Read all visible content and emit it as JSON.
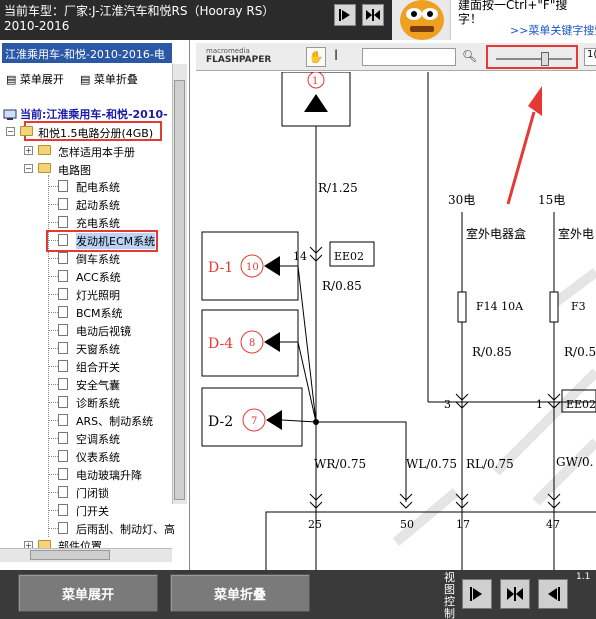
{
  "header": {
    "car_label": "当前车型：厂家:J-江淮汽车和悦RS（Hooray RS）",
    "car_year": "2010-2016",
    "btn_prev_icon": "arrow-right-icon",
    "btn_split_icon": "double-arrow-icon"
  },
  "promo": {
    "line1": "建面按一Ctrl+\"F\"搜",
    "line2": "字！",
    "link": ">>菜单关键字搜索"
  },
  "sidebar": {
    "title": "江淮乘用车-和悦-2010-2016-电",
    "expand_label": "菜单展开",
    "collapse_label": "菜单折叠",
    "current": "当前:江淮乘用车-和悦-2010-",
    "root_folder": "和悦1.5电路分册(4GB)",
    "folder_howto": "怎样适用本手册",
    "folder_circuit": "电路图",
    "items": [
      "配电系统",
      "起动系统",
      "充电系统",
      "发动机ECM系统",
      "倒车系统",
      "ACC系统",
      "灯光照明",
      "BCM系统",
      "电动后视镜",
      "天窗系统",
      "组合开关",
      "安全气囊",
      "诊断系统",
      "ARS、制动系统",
      "空调系统",
      "仪表系统",
      "电动玻璃升降",
      "门闭锁",
      "门开关",
      "后雨刮、制动灯、高"
    ],
    "folder_parts": "部件位置"
  },
  "toolbar": {
    "logo_brand": "macromedia",
    "logo_product": "FLASHPAPER",
    "zoom_value": "1("
  },
  "diagram": {
    "labels": {
      "r125": "R/1.25",
      "num14": "14",
      "ee02a": "EE02",
      "r085a": "R/0.85",
      "d1": "D-1",
      "n10": "10",
      "d4": "D-4",
      "n8": "8",
      "d2": "D-2",
      "n7": "7",
      "n1": "1",
      "e30": "30电",
      "e15": "15电",
      "outbox1": "室外电器盒",
      "outbox2": "室外电",
      "f14": "F14 10A",
      "f3": "F3",
      "r085b": "R/0.85",
      "r05": "R/0.5",
      "n3": "3",
      "n1b": "1",
      "ee02b": "EE02",
      "wr": "WR/0.75",
      "wl": "WL/0.75",
      "rl": "RL/0.75",
      "gw": "GW/0.",
      "p25": "25",
      "p50": "50",
      "p17": "17",
      "p47": "47"
    }
  },
  "bottom": {
    "expand_label": "菜单展开",
    "collapse_label": "菜单折叠",
    "view_control": "视图控制",
    "page_no": "1.1"
  }
}
